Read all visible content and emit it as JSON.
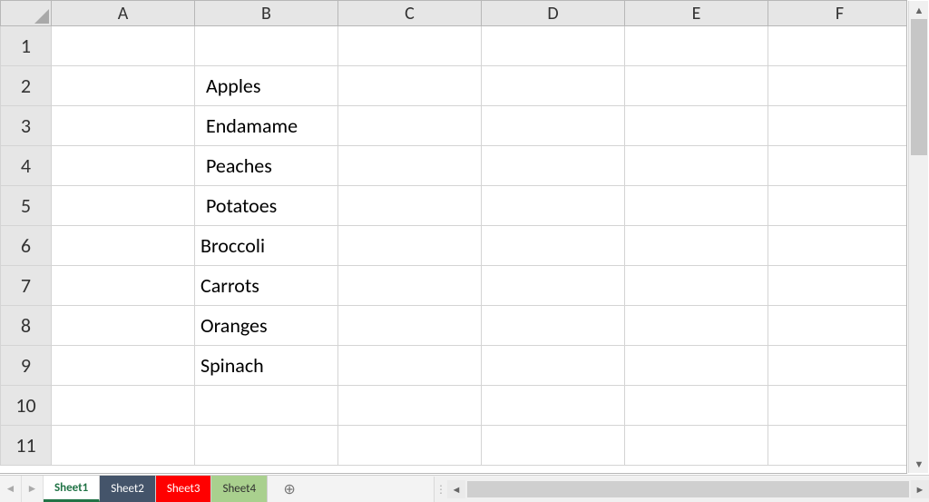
{
  "columns": [
    "A",
    "B",
    "C",
    "D",
    "E",
    "F"
  ],
  "rows": [
    "1",
    "2",
    "3",
    "4",
    "5",
    "6",
    "7",
    "8",
    "9",
    "10",
    "11"
  ],
  "cells": {
    "B2": "Apples",
    "B3": "Endamame",
    "B4": "Peaches",
    "B5": "Potatoes",
    "B6": "Broccoli",
    "B7": "Carrots",
    "B8": "Oranges",
    "B9": "Spinach"
  },
  "sheet_tabs": [
    {
      "label": "Sheet1",
      "style": "active"
    },
    {
      "label": "Sheet2",
      "style": "dark"
    },
    {
      "label": "Sheet3",
      "style": "red"
    },
    {
      "label": "Sheet4",
      "style": "green"
    }
  ],
  "icons": {
    "add_sheet": "⊕",
    "nav_prev": "◄",
    "nav_next": "►",
    "up": "▲",
    "down": "▼",
    "dots": "⋮"
  }
}
